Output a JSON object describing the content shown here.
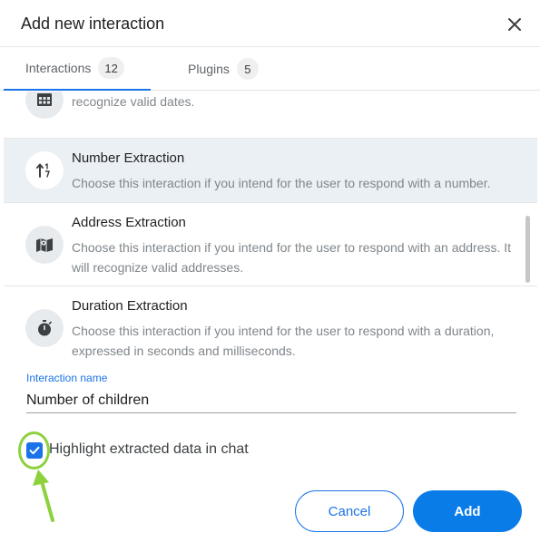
{
  "dialog": {
    "title": "Add new interaction"
  },
  "tabs": [
    {
      "label": "Interactions",
      "count": "12",
      "active": true
    },
    {
      "label": "Plugins",
      "count": "5",
      "active": false
    }
  ],
  "interactions": [
    {
      "name": "",
      "icon": "calendar-icon",
      "description": "Choose this interaction if you intend for the user to respond with a date. It will recognize valid dates.",
      "selected": false
    },
    {
      "name": "Number Extraction",
      "icon": "number-sort-icon",
      "description": "Choose this interaction if you intend for the user to respond with a number.",
      "selected": true
    },
    {
      "name": "Address Extraction",
      "icon": "map-icon",
      "description": "Choose this interaction if you intend for the user to respond with an address. It will recognize valid addresses.",
      "selected": false
    },
    {
      "name": "Duration Extraction",
      "icon": "stopwatch-icon",
      "description": "Choose this interaction if you intend for the user to respond with a duration, expressed in seconds and milliseconds.",
      "selected": false
    }
  ],
  "form": {
    "interaction_name_label": "Interaction name",
    "interaction_name_value": "Number of children",
    "highlight_label": "Highlight extracted data in chat",
    "highlight_checked": true
  },
  "actions": {
    "cancel_label": "Cancel",
    "add_label": "Add"
  },
  "colors": {
    "accent": "#1a73e8",
    "add_button": "#0a7ce8",
    "selected_row": "#ebf0f4",
    "annotation": "#8dd13d"
  }
}
